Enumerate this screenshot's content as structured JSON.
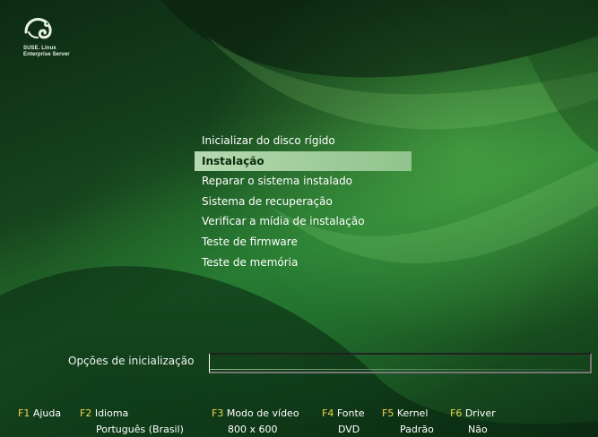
{
  "brand": {
    "logo_text": "SUSE. Linux\nEnterprise Server"
  },
  "menu": {
    "items": [
      {
        "label": "Inicializar do disco rígido",
        "selected": false
      },
      {
        "label": "Instalação",
        "selected": true
      },
      {
        "label": "Reparar o sistema instalado",
        "selected": false
      },
      {
        "label": "Sistema de recuperação",
        "selected": false
      },
      {
        "label": "Verificar a mídia de instalação",
        "selected": false
      },
      {
        "label": "Teste de firmware",
        "selected": false
      },
      {
        "label": "Teste de memória",
        "selected": false
      }
    ]
  },
  "boot_options": {
    "label": "Opções de inicialização",
    "value": ""
  },
  "function_keys": [
    {
      "key": "F1",
      "name": "Ajuda",
      "value": ""
    },
    {
      "key": "F2",
      "name": "Idioma",
      "value": "Português (Brasil)"
    },
    {
      "key": "F3",
      "name": "Modo de vídeo",
      "value": "800 x 600"
    },
    {
      "key": "F4",
      "name": "Fonte",
      "value": "DVD"
    },
    {
      "key": "F5",
      "name": "Kernel",
      "value": "Padrão"
    },
    {
      "key": "F6",
      "name": "Driver",
      "value": "Não"
    }
  ],
  "colors": {
    "fkey_accent": "#f2d34a",
    "selection": "#b9dfb3",
    "background_green": "#2a7a30"
  }
}
